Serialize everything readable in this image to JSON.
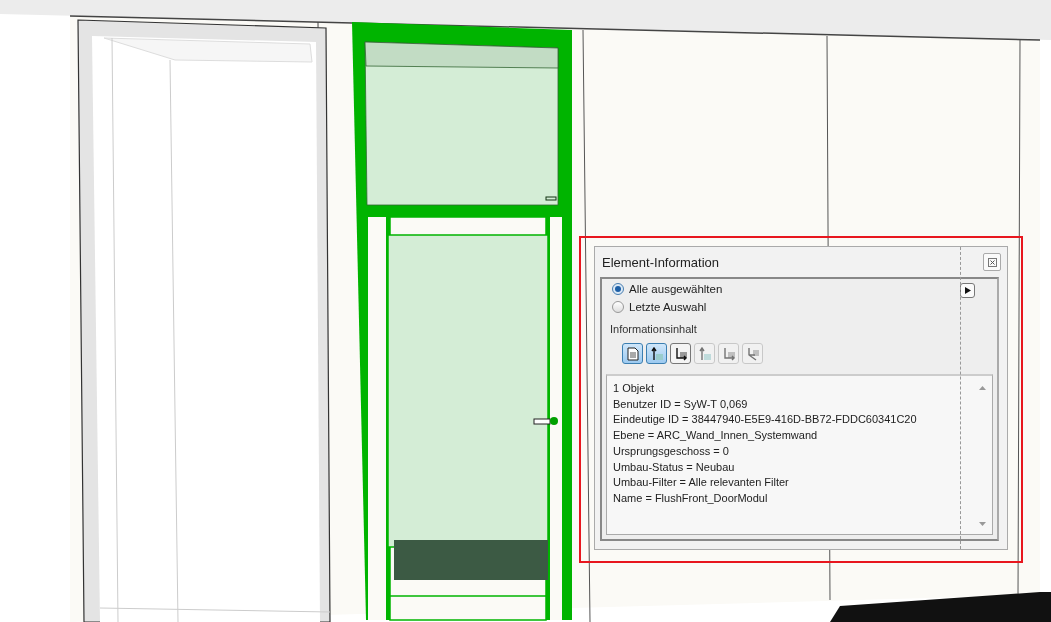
{
  "dialog": {
    "title": "Element-Information",
    "radios": [
      {
        "label": "Alle ausgewählten",
        "selected": true
      },
      {
        "label": "Letzte Auswahl",
        "selected": false
      }
    ],
    "section_label": "Informationsinhalt",
    "toolbar": [
      {
        "kind": "document",
        "selected": true,
        "disabled": false
      },
      {
        "kind": "up",
        "selected": true,
        "disabled": false
      },
      {
        "kind": "corner",
        "selected": false,
        "disabled": false
      },
      {
        "kind": "up",
        "selected": false,
        "disabled": true
      },
      {
        "kind": "corner",
        "selected": false,
        "disabled": true
      },
      {
        "kind": "branch",
        "selected": false,
        "disabled": true
      }
    ],
    "info_lines": [
      "1 Objekt",
      "Benutzer ID = SyW-T 0,069",
      "Eindeutige ID = 38447940-E5E9-416D-BB72-FDDC60341C20",
      "Ebene = ARC_Wand_Innen_Systemwand",
      "Ursprungsgeschoss = 0",
      "Umbau-Status = Neubau",
      "Umbau-Filter = Alle relevanten Filter",
      "Name = FlushFront_DoorModul"
    ]
  }
}
